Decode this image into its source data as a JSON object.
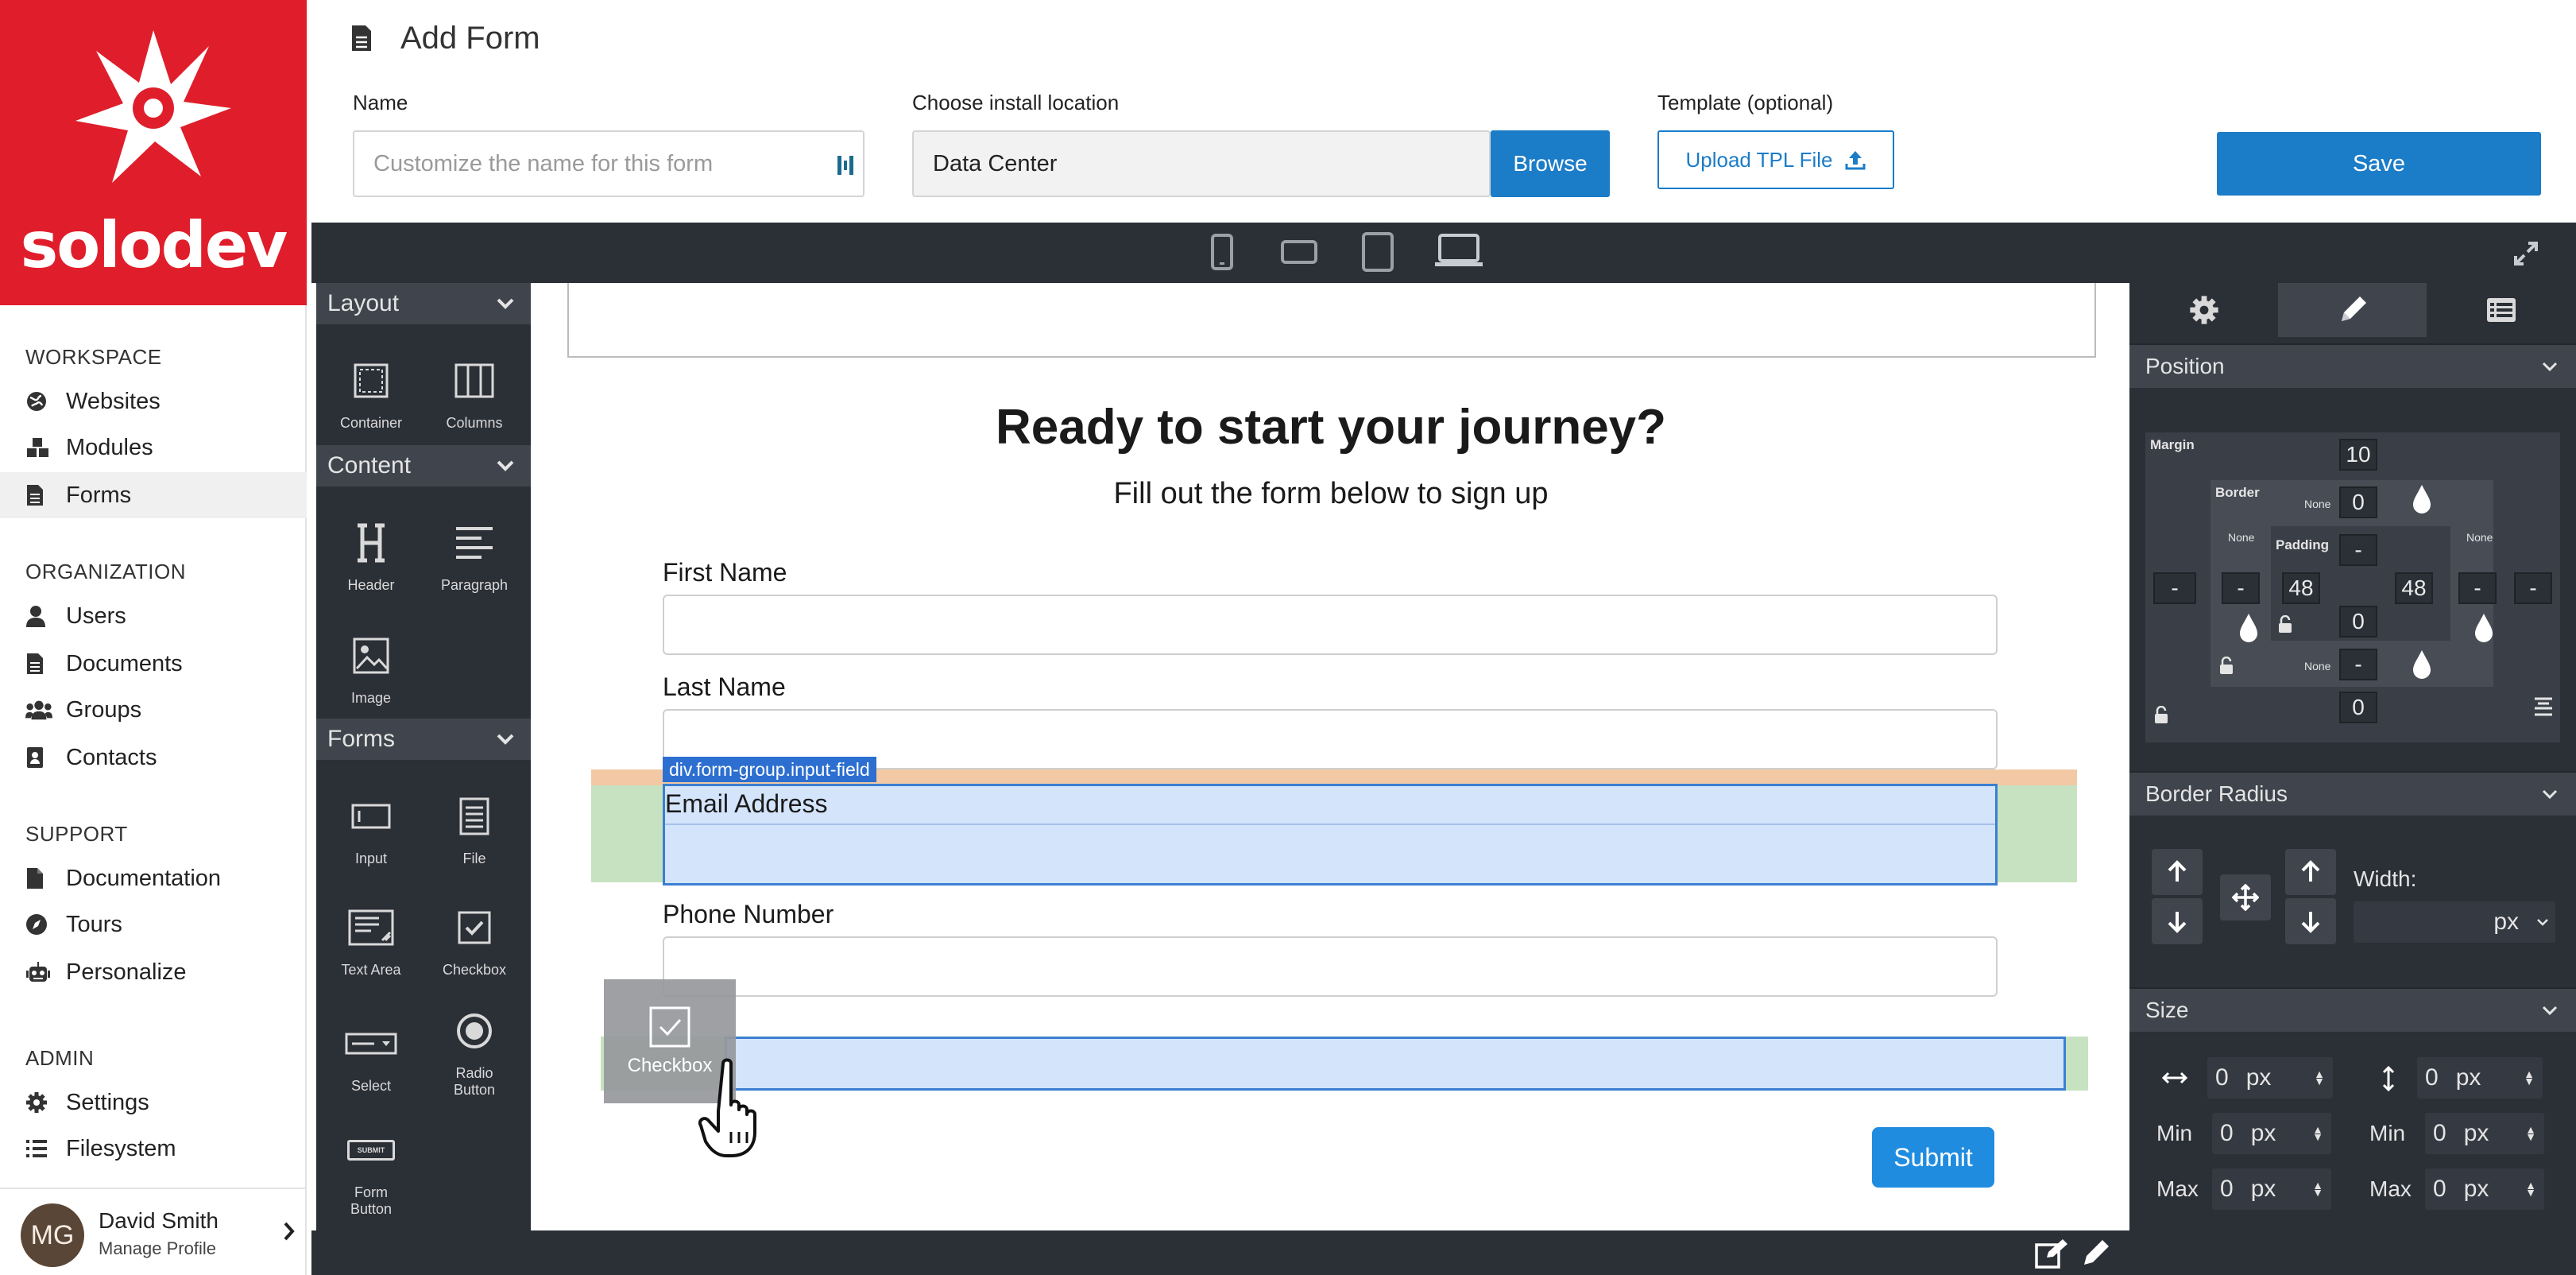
{
  "brand": {
    "name": "solodev",
    "color": "#e01e2b"
  },
  "sidebar": {
    "sections": [
      {
        "title": "WORKSPACE",
        "items": [
          {
            "label": "Websites",
            "icon": "globe-icon"
          },
          {
            "label": "Modules",
            "icon": "cubes-icon"
          },
          {
            "label": "Forms",
            "icon": "form-document-icon",
            "active": true
          }
        ]
      },
      {
        "title": "ORGANIZATION",
        "items": [
          {
            "label": "Users",
            "icon": "user-icon"
          },
          {
            "label": "Documents",
            "icon": "document-icon"
          },
          {
            "label": "Groups",
            "icon": "users-icon"
          },
          {
            "label": "Contacts",
            "icon": "address-book-icon"
          }
        ]
      },
      {
        "title": "SUPPORT",
        "items": [
          {
            "label": "Documentation",
            "icon": "file-icon"
          },
          {
            "label": "Tours",
            "icon": "compass-icon"
          },
          {
            "label": "Personalize",
            "icon": "robot-icon"
          }
        ]
      },
      {
        "title": "ADMIN",
        "items": [
          {
            "label": "Settings",
            "icon": "gear-icon"
          },
          {
            "label": "Filesystem",
            "icon": "list-icon"
          }
        ]
      }
    ],
    "profile": {
      "initials": "MG",
      "name": "David Smith",
      "subtitle": "Manage Profile"
    }
  },
  "header": {
    "title": "Add Form",
    "name_label": "Name",
    "name_placeholder": "Customize the name for this form",
    "location_label": "Choose install location",
    "location_value": "Data Center",
    "browse_label": "Browse",
    "template_label": "Template (optional)",
    "upload_label": "Upload TPL File",
    "save_label": "Save",
    "accent": "#1b7cc8"
  },
  "blocks_panel": {
    "categories": [
      {
        "title": "Layout",
        "blocks": [
          {
            "label": "Container",
            "icon": "container-icon"
          },
          {
            "label": "Columns",
            "icon": "columns-icon"
          }
        ]
      },
      {
        "title": "Content",
        "blocks": [
          {
            "label": "Header",
            "icon": "header-icon"
          },
          {
            "label": "Paragraph",
            "icon": "paragraph-icon"
          },
          {
            "label": "Image",
            "icon": "image-icon"
          }
        ]
      },
      {
        "title": "Forms",
        "blocks": [
          {
            "label": "Input",
            "icon": "input-icon"
          },
          {
            "label": "File",
            "icon": "file-block-icon"
          },
          {
            "label": "Text Area",
            "icon": "textarea-icon"
          },
          {
            "label": "Checkbox",
            "icon": "checkbox-icon"
          },
          {
            "label": "Select",
            "icon": "select-icon"
          },
          {
            "label": "Radio Button",
            "icon": "radio-icon"
          },
          {
            "label": "Form Button",
            "icon": "form-button-icon",
            "badge": "SUBMIT"
          }
        ]
      }
    ]
  },
  "canvas": {
    "headline": "Ready to start your journey?",
    "subheadline": "Fill out the form below to sign up",
    "fields": [
      {
        "label": "First Name"
      },
      {
        "label": "Last Name"
      },
      {
        "label": "Email Address",
        "selected": true
      },
      {
        "label": "Phone Number"
      }
    ],
    "selection_tag": "div.form-group.input-field",
    "drag_ghost_label": "Checkbox",
    "submit_label": "Submit",
    "selection_color": "#3b7fd1",
    "drop_color": "#c7e2c1"
  },
  "style_panel": {
    "tabs": [
      {
        "icon": "gear-icon"
      },
      {
        "icon": "pencil-icon",
        "active": true
      },
      {
        "icon": "layers-list-icon"
      }
    ],
    "position": {
      "title": "Position",
      "margin_label": "Margin",
      "border_label": "Border",
      "padding_label": "Padding",
      "none_label": "None",
      "margin": {
        "top": "10",
        "right": "-",
        "bottom": "0",
        "left": "-"
      },
      "border": {
        "top": "0",
        "right": "-",
        "bottom": "-",
        "left": "-"
      },
      "padding": {
        "top": "-",
        "right": "48",
        "bottom": "0",
        "left": "48"
      }
    },
    "border_radius": {
      "title": "Border Radius",
      "width_label": "Width:",
      "unit": "px"
    },
    "size": {
      "title": "Size",
      "min_label": "Min",
      "max_label": "Max",
      "unit": "px",
      "width": "0",
      "height": "0",
      "min_width": "0",
      "min_height": "0",
      "max_width": "0",
      "max_height": "0"
    }
  }
}
